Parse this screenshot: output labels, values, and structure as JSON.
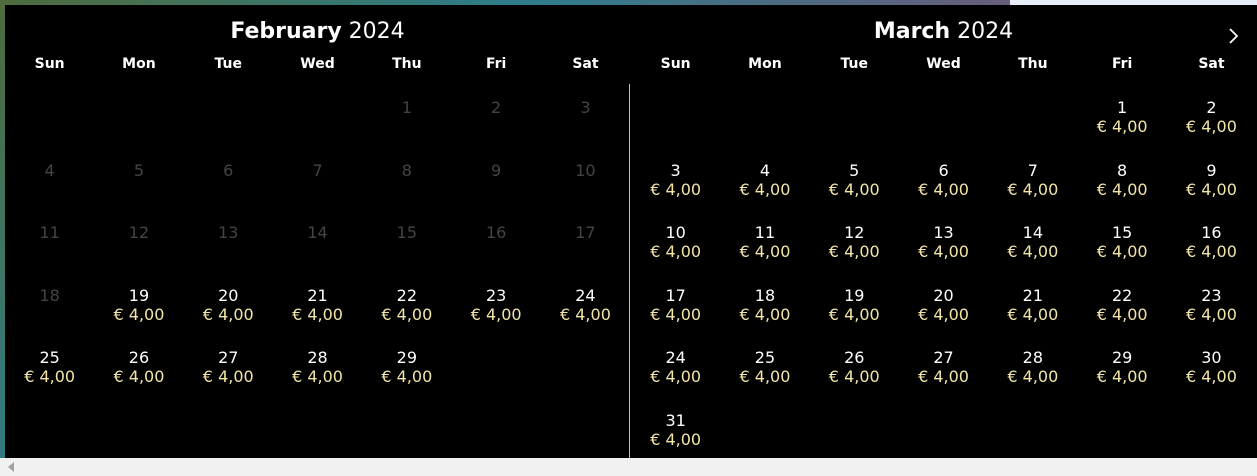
{
  "calendar": {
    "weekdays": [
      "Sun",
      "Mon",
      "Tue",
      "Wed",
      "Thu",
      "Fri",
      "Sat"
    ],
    "months": [
      {
        "name": "February",
        "year": "2024",
        "days": [
          {
            "num": "",
            "price": "",
            "disabled": false,
            "blank": true
          },
          {
            "num": "",
            "price": "",
            "disabled": false,
            "blank": true
          },
          {
            "num": "",
            "price": "",
            "disabled": false,
            "blank": true
          },
          {
            "num": "",
            "price": "",
            "disabled": false,
            "blank": true
          },
          {
            "num": "1",
            "price": "",
            "disabled": true
          },
          {
            "num": "2",
            "price": "",
            "disabled": true
          },
          {
            "num": "3",
            "price": "",
            "disabled": true
          },
          {
            "num": "4",
            "price": "",
            "disabled": true
          },
          {
            "num": "5",
            "price": "",
            "disabled": true
          },
          {
            "num": "6",
            "price": "",
            "disabled": true
          },
          {
            "num": "7",
            "price": "",
            "disabled": true
          },
          {
            "num": "8",
            "price": "",
            "disabled": true
          },
          {
            "num": "9",
            "price": "",
            "disabled": true
          },
          {
            "num": "10",
            "price": "",
            "disabled": true
          },
          {
            "num": "11",
            "price": "",
            "disabled": true
          },
          {
            "num": "12",
            "price": "",
            "disabled": true
          },
          {
            "num": "13",
            "price": "",
            "disabled": true
          },
          {
            "num": "14",
            "price": "",
            "disabled": true
          },
          {
            "num": "15",
            "price": "",
            "disabled": true
          },
          {
            "num": "16",
            "price": "",
            "disabled": true
          },
          {
            "num": "17",
            "price": "",
            "disabled": true
          },
          {
            "num": "18",
            "price": "",
            "disabled": true
          },
          {
            "num": "19",
            "price": "€ 4,00",
            "disabled": false
          },
          {
            "num": "20",
            "price": "€ 4,00",
            "disabled": false
          },
          {
            "num": "21",
            "price": "€ 4,00",
            "disabled": false
          },
          {
            "num": "22",
            "price": "€ 4,00",
            "disabled": false
          },
          {
            "num": "23",
            "price": "€ 4,00",
            "disabled": false
          },
          {
            "num": "24",
            "price": "€ 4,00",
            "disabled": false
          },
          {
            "num": "25",
            "price": "€ 4,00",
            "disabled": false
          },
          {
            "num": "26",
            "price": "€ 4,00",
            "disabled": false
          },
          {
            "num": "27",
            "price": "€ 4,00",
            "disabled": false
          },
          {
            "num": "28",
            "price": "€ 4,00",
            "disabled": false
          },
          {
            "num": "29",
            "price": "€ 4,00",
            "disabled": false
          }
        ]
      },
      {
        "name": "March",
        "year": "2024",
        "days": [
          {
            "num": "",
            "price": "",
            "disabled": false,
            "blank": true
          },
          {
            "num": "",
            "price": "",
            "disabled": false,
            "blank": true
          },
          {
            "num": "",
            "price": "",
            "disabled": false,
            "blank": true
          },
          {
            "num": "",
            "price": "",
            "disabled": false,
            "blank": true
          },
          {
            "num": "",
            "price": "",
            "disabled": false,
            "blank": true
          },
          {
            "num": "1",
            "price": "€ 4,00",
            "disabled": false
          },
          {
            "num": "2",
            "price": "€ 4,00",
            "disabled": false
          },
          {
            "num": "3",
            "price": "€ 4,00",
            "disabled": false
          },
          {
            "num": "4",
            "price": "€ 4,00",
            "disabled": false
          },
          {
            "num": "5",
            "price": "€ 4,00",
            "disabled": false
          },
          {
            "num": "6",
            "price": "€ 4,00",
            "disabled": false
          },
          {
            "num": "7",
            "price": "€ 4,00",
            "disabled": false
          },
          {
            "num": "8",
            "price": "€ 4,00",
            "disabled": false
          },
          {
            "num": "9",
            "price": "€ 4,00",
            "disabled": false
          },
          {
            "num": "10",
            "price": "€ 4,00",
            "disabled": false
          },
          {
            "num": "11",
            "price": "€ 4,00",
            "disabled": false
          },
          {
            "num": "12",
            "price": "€ 4,00",
            "disabled": false
          },
          {
            "num": "13",
            "price": "€ 4,00",
            "disabled": false
          },
          {
            "num": "14",
            "price": "€ 4,00",
            "disabled": false
          },
          {
            "num": "15",
            "price": "€ 4,00",
            "disabled": false
          },
          {
            "num": "16",
            "price": "€ 4,00",
            "disabled": false
          },
          {
            "num": "17",
            "price": "€ 4,00",
            "disabled": false
          },
          {
            "num": "18",
            "price": "€ 4,00",
            "disabled": false
          },
          {
            "num": "19",
            "price": "€ 4,00",
            "disabled": false
          },
          {
            "num": "20",
            "price": "€ 4,00",
            "disabled": false
          },
          {
            "num": "21",
            "price": "€ 4,00",
            "disabled": false
          },
          {
            "num": "22",
            "price": "€ 4,00",
            "disabled": false
          },
          {
            "num": "23",
            "price": "€ 4,00",
            "disabled": false
          },
          {
            "num": "24",
            "price": "€ 4,00",
            "disabled": false
          },
          {
            "num": "25",
            "price": "€ 4,00",
            "disabled": false
          },
          {
            "num": "26",
            "price": "€ 4,00",
            "disabled": false
          },
          {
            "num": "27",
            "price": "€ 4,00",
            "disabled": false
          },
          {
            "num": "28",
            "price": "€ 4,00",
            "disabled": false
          },
          {
            "num": "29",
            "price": "€ 4,00",
            "disabled": false
          },
          {
            "num": "30",
            "price": "€ 4,00",
            "disabled": false
          },
          {
            "num": "31",
            "price": "€ 4,00",
            "disabled": false
          }
        ]
      }
    ],
    "next_icon": "chevron-right-icon",
    "colors": {
      "background": "#000000",
      "text": "#ffffff",
      "price": "#f2e6a6",
      "disabled": "#444444",
      "divider": "#bdbdbd"
    }
  },
  "scrollbar": {
    "left_icon": "scroll-left-arrow-icon"
  }
}
